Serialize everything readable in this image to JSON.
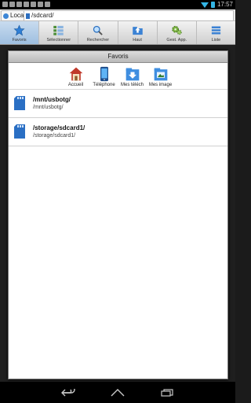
{
  "status": {
    "time": "17:57"
  },
  "address": {
    "location_label": "Local",
    "path": "/sdcard/"
  },
  "toolbar": {
    "items": [
      {
        "label": "Favoris",
        "icon": "star-icon"
      },
      {
        "label": "Sélectionner",
        "icon": "select-grid-icon"
      },
      {
        "label": "Rechercher",
        "icon": "search-icon"
      },
      {
        "label": "Haut",
        "icon": "up-folder-icon"
      },
      {
        "label": "Gest. App.",
        "icon": "gears-icon"
      },
      {
        "label": "Liste",
        "icon": "list-icon"
      }
    ]
  },
  "dialog": {
    "title": "Favoris",
    "quick": [
      {
        "label": "Accueil",
        "icon": "home-icon"
      },
      {
        "label": "Téléphone",
        "icon": "phone-icon"
      },
      {
        "label": "Mes téléch",
        "icon": "downloads-folder-icon"
      },
      {
        "label": "Mes image",
        "icon": "images-folder-icon"
      }
    ],
    "favorites": [
      {
        "title": "/mnt/usbotg/",
        "path": "/mnt/usbotg/"
      },
      {
        "title": "/storage/sdcard1/",
        "path": "/storage/sdcard1/"
      }
    ]
  },
  "colors": {
    "accent": "#33b5e5",
    "toolbar_active": "#9ebfe0"
  }
}
